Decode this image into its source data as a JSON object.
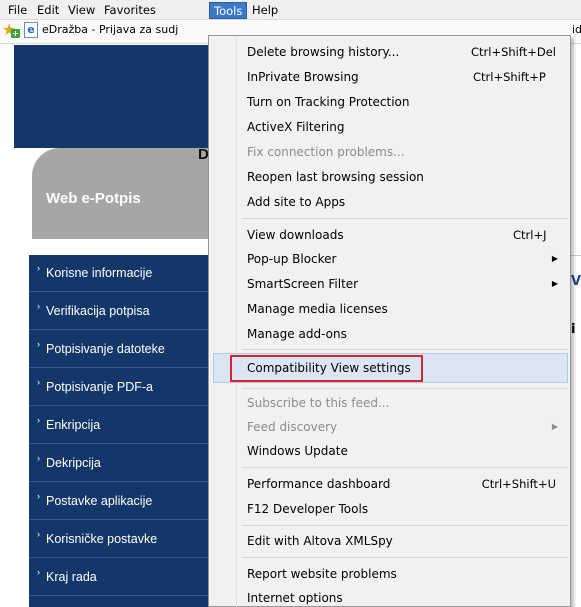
{
  "menubar": {
    "items": [
      "File",
      "Edit",
      "View",
      "Favorites",
      "Tools",
      "Help"
    ],
    "active": "Tools"
  },
  "favorites_bar": {
    "tab_text": "eDražba - Prijava za sudj",
    "right_fragment": "id"
  },
  "site": {
    "partial_heading_letter": "D",
    "tab_label": "Web e-Potpis",
    "nav_items": [
      "Korisne informacije",
      "Verifikacija potpisa",
      "Potpisivanje datoteke",
      "Potpisivanje PDF-a",
      "Enkripcija",
      "Dekripcija",
      "Postavke aplikacije",
      "Korisničke postavke",
      "Kraj rada"
    ],
    "right_fragments": [
      "V",
      "i"
    ]
  },
  "tools_menu": {
    "delete_history": {
      "label": "Delete browsing history...",
      "shortcut": "Ctrl+Shift+Del"
    },
    "inprivate": {
      "label": "InPrivate Browsing",
      "shortcut": "Ctrl+Shift+P"
    },
    "tracking_protection": {
      "label": "Turn on Tracking Protection"
    },
    "activex": {
      "label": "ActiveX Filtering"
    },
    "fix_connection": {
      "label": "Fix connection problems..."
    },
    "reopen_session": {
      "label": "Reopen last browsing session"
    },
    "add_site": {
      "label": "Add site to Apps"
    },
    "view_downloads": {
      "label": "View downloads",
      "shortcut": "Ctrl+J"
    },
    "popup_blocker": {
      "label": "Pop-up Blocker"
    },
    "smartscreen": {
      "label": "SmartScreen Filter"
    },
    "media_licenses": {
      "label": "Manage media licenses"
    },
    "addons": {
      "label": "Manage add-ons"
    },
    "compat_view": {
      "label": "Compatibility View settings"
    },
    "subscribe_feed": {
      "label": "Subscribe to this feed..."
    },
    "feed_discovery": {
      "label": "Feed discovery"
    },
    "windows_update": {
      "label": "Windows Update"
    },
    "perf_dashboard": {
      "label": "Performance dashboard",
      "shortcut": "Ctrl+Shift+U"
    },
    "f12_tools": {
      "label": "F12 Developer Tools"
    },
    "xmlspy": {
      "label": "Edit with Altova XMLSpy"
    },
    "report_problems": {
      "label": "Report website problems"
    },
    "internet_options": {
      "label": "Internet options"
    }
  },
  "colors": {
    "nav_background": "#14376a",
    "active_menu": "#3b79c9",
    "highlight_fill": "#dbe6f4",
    "highlight_outline": "#d8252a"
  }
}
